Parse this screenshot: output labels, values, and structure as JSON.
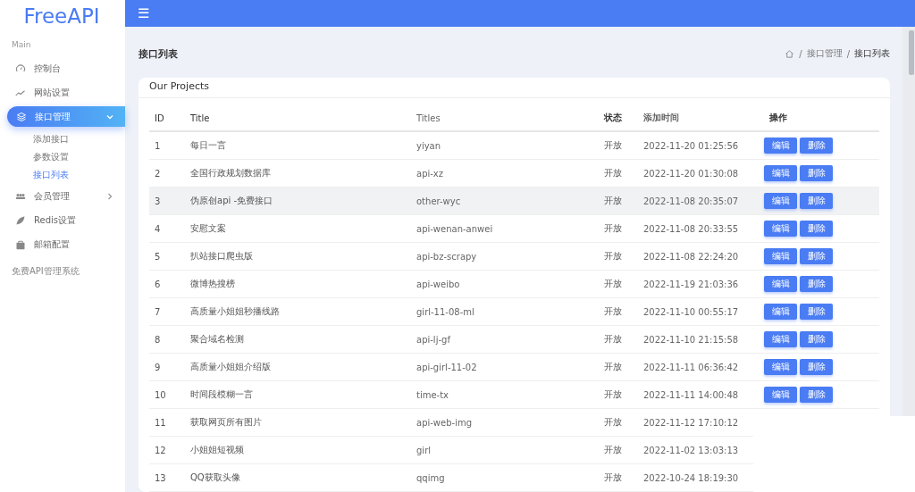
{
  "sidebar": {
    "logo": "FreeAPI",
    "section": "Main",
    "items": [
      {
        "label": "控制台",
        "selected": false
      },
      {
        "label": "网站设置",
        "selected": false
      },
      {
        "label": "接口管理",
        "selected": true,
        "expanded": true,
        "children": [
          {
            "label": "添加接口",
            "selected": false
          },
          {
            "label": "参数设置",
            "selected": false
          },
          {
            "label": "接口列表",
            "selected": true
          }
        ]
      },
      {
        "label": "会员管理",
        "selected": false,
        "expanded": false
      },
      {
        "label": "Redis设置",
        "selected": false
      },
      {
        "label": "邮箱配置",
        "selected": false
      }
    ],
    "footer": "免费API管理系统"
  },
  "topbar": {
    "menu_icon": "☰"
  },
  "page": {
    "title": "接口列表",
    "breadcrumb": [
      {
        "separator": "/",
        "label": "接口管理"
      },
      {
        "separator": "/",
        "label": "接口列表"
      }
    ]
  },
  "card": {
    "title": "Our Projects"
  },
  "table": {
    "columns": [
      "ID",
      "Title",
      "Titles",
      "状态",
      "添加时间",
      "操作"
    ],
    "rows": [
      {
        "cells": [
          "1",
          "每日一言",
          "yiyan",
          "开放",
          "2022-11-20 01:25:56"
        ],
        "highlighted": false,
        "buttons": [
          "编辑",
          "删除"
        ]
      },
      {
        "cells": [
          "2",
          "全国行政规划数据库",
          "api-xz",
          "开放",
          "2022-11-20 01:30:08"
        ],
        "highlighted": false,
        "buttons": [
          "编辑",
          "删除"
        ]
      },
      {
        "cells": [
          "3",
          "伪原创api -免费接口",
          "other-wyc",
          "开放",
          "2022-11-08 20:35:07"
        ],
        "highlighted": true,
        "buttons": [
          "编辑",
          "删除"
        ]
      },
      {
        "cells": [
          "4",
          "安慰文案",
          "api-wenan-anwei",
          "开放",
          "2022-11-08 20:33:55"
        ],
        "highlighted": false,
        "buttons": [
          "编辑",
          "删除"
        ]
      },
      {
        "cells": [
          "5",
          "扒站接口爬虫版",
          "api-bz-scrapy",
          "开放",
          "2022-11-08 22:24:20"
        ],
        "highlighted": false,
        "buttons": [
          "编辑",
          "删除"
        ]
      },
      {
        "cells": [
          "6",
          "微博热搜榜",
          "api-weibo",
          "开放",
          "2022-11-19 21:03:36"
        ],
        "highlighted": false,
        "buttons": [
          "编辑",
          "删除"
        ]
      },
      {
        "cells": [
          "7",
          "高质量小姐姐秒播线路",
          "girl-11-08-ml",
          "开放",
          "2022-11-10 00:55:17"
        ],
        "highlighted": false,
        "buttons": [
          "编辑",
          "删除"
        ]
      },
      {
        "cells": [
          "8",
          "聚合域名检测",
          "api-lj-gf",
          "开放",
          "2022-11-10 21:15:58"
        ],
        "highlighted": false,
        "buttons": [
          "编辑",
          "删除"
        ]
      },
      {
        "cells": [
          "9",
          "高质量小姐姐介绍版",
          "api-girl-11-02",
          "开放",
          "2022-11-11 06:36:42"
        ],
        "highlighted": false,
        "buttons": [
          "编辑",
          "删除"
        ]
      },
      {
        "cells": [
          "10",
          "时间段模糊一言",
          "time-tx",
          "开放",
          "2022-11-11 14:00:48"
        ],
        "highlighted": false,
        "buttons": [
          "编辑",
          "删除"
        ]
      },
      {
        "cells": [
          "11",
          "获取网页所有图片",
          "api-web-img",
          "开放",
          "2022-11-12 17:10:12"
        ],
        "highlighted": false
      },
      {
        "cells": [
          "12",
          "小姐姐短视频",
          "girl",
          "开放",
          "2022-11-02 13:03:13"
        ],
        "highlighted": false
      },
      {
        "cells": [
          "13",
          "QQ获取头像",
          "qqimg",
          "开放",
          "2022-10-24 18:19:30"
        ],
        "highlighted": false
      }
    ]
  }
}
